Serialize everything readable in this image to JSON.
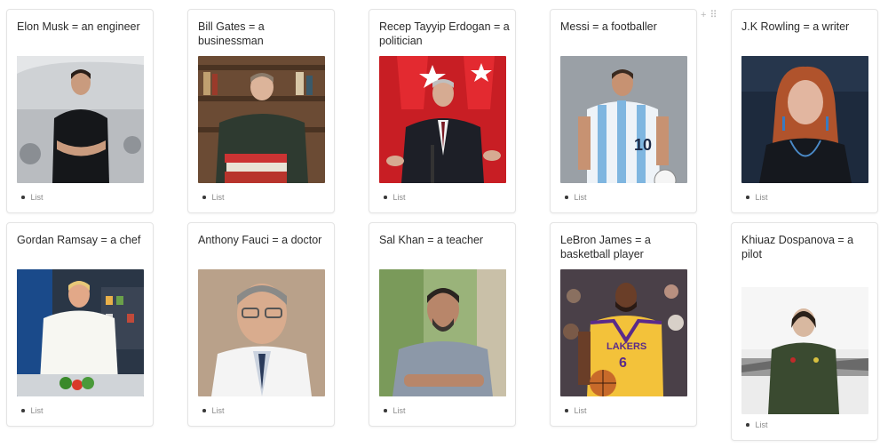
{
  "cards": [
    {
      "title": "Elon Musk = an engineer",
      "list_label": "List",
      "image": "portrait-elon-musk"
    },
    {
      "title": "Bill Gates = a businessman",
      "list_label": "List",
      "image": "portrait-bill-gates"
    },
    {
      "title": "Recep Tayyip Erdogan = a politician",
      "list_label": "List",
      "image": "portrait-erdogan"
    },
    {
      "title": "Messi = a footballer",
      "list_label": "List",
      "image": "portrait-messi"
    },
    {
      "title": "J.K Rowling = a writer",
      "list_label": "List",
      "image": "portrait-jk-rowling"
    },
    {
      "title": "Gordan Ramsay = a chef",
      "list_label": "List",
      "image": "portrait-gordon-ramsay"
    },
    {
      "title": "Anthony Fauci = a doctor",
      "list_label": "List",
      "image": "portrait-anthony-fauci"
    },
    {
      "title": "Sal Khan = a teacher",
      "list_label": "List",
      "image": "portrait-sal-khan"
    },
    {
      "title": "LeBron James = a basketball player",
      "list_label": "List",
      "image": "portrait-lebron-james"
    },
    {
      "title": "Khiuaz Dospanova = a pilot",
      "list_label": "List",
      "image": "portrait-khiuaz-dospanova"
    }
  ],
  "hover_controls": {
    "add": "+",
    "drag": "⠿"
  }
}
